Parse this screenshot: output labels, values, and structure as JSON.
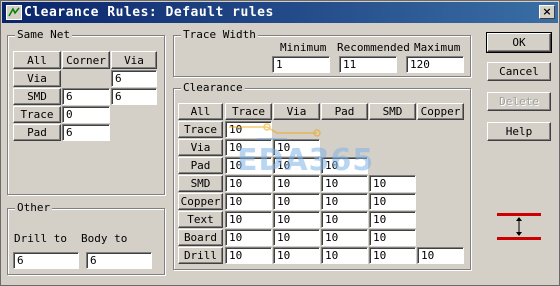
{
  "window": {
    "title": "Clearance Rules: Default rules",
    "close_glyph": "×"
  },
  "same_net": {
    "title": "Same Net",
    "all_label": "All",
    "col_headers": [
      "Corner",
      "Via"
    ],
    "rows": [
      {
        "label": "Via",
        "corner": null,
        "via": "6"
      },
      {
        "label": "SMD",
        "corner": "6",
        "via": "6"
      },
      {
        "label": "Trace",
        "corner": "0",
        "via": null
      },
      {
        "label": "Pad",
        "corner": "6",
        "via": null
      }
    ]
  },
  "other": {
    "title": "Other",
    "drill_to_label": "Drill to",
    "body_to_label": "Body to",
    "drill_to_value": "6",
    "body_to_value": "6"
  },
  "trace_width": {
    "title": "Trace Width",
    "minimum_label": "Minimum",
    "recommended_label": "Recommended",
    "maximum_label": "Maximum",
    "minimum": "1",
    "recommended": "11",
    "maximum": "120"
  },
  "clearance": {
    "title": "Clearance",
    "all_label": "All",
    "col_headers": [
      "Trace",
      "Via",
      "Pad",
      "SMD",
      "Copper"
    ],
    "rows": [
      {
        "label": "Trace",
        "values": [
          "10"
        ]
      },
      {
        "label": "Via",
        "values": [
          "10",
          "10"
        ]
      },
      {
        "label": "Pad",
        "values": [
          "10",
          "10",
          "10"
        ]
      },
      {
        "label": "SMD",
        "values": [
          "10",
          "10",
          "10",
          "10"
        ]
      },
      {
        "label": "Copper",
        "values": [
          "10",
          "10",
          "10",
          "10"
        ]
      },
      {
        "label": "Text",
        "values": [
          "10",
          "10",
          "10",
          "10"
        ]
      },
      {
        "label": "Board",
        "values": [
          "10",
          "10",
          "10",
          "10"
        ]
      },
      {
        "label": "Drill",
        "values": [
          "10",
          "10",
          "10",
          "10",
          "10"
        ]
      }
    ]
  },
  "buttons": {
    "ok": "OK",
    "cancel": "Cancel",
    "delete": "Delete",
    "help": "Help"
  },
  "watermark": {
    "text": "EDA365"
  },
  "colors": {
    "title_bar": "#0a246a",
    "face": "#d4d0c8",
    "clearance_icon": "#cc0000",
    "watermark": "#7fb3e6"
  },
  "icons": [
    "app-icon",
    "close-icon",
    "clearance-gap-icon"
  ]
}
